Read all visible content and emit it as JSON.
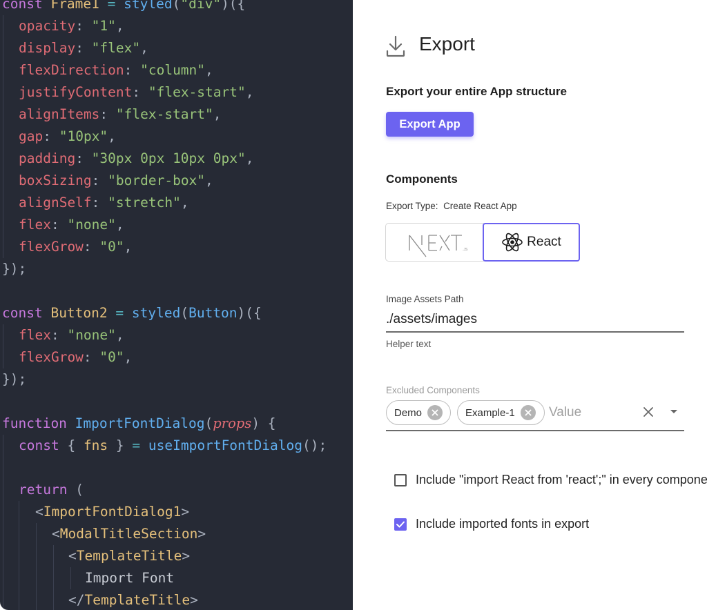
{
  "code_editor": {
    "lines": [
      {
        "indent": 0,
        "tokens": [
          [
            "kw",
            "const"
          ],
          [
            "txt",
            " "
          ],
          [
            "cls",
            "Frame1"
          ],
          [
            "txt",
            " "
          ],
          [
            "op",
            "="
          ],
          [
            "txt",
            " "
          ],
          [
            "fn",
            "styled"
          ],
          [
            "punc",
            "("
          ],
          [
            "str",
            "\"div\""
          ],
          [
            "punc",
            ")({"
          ]
        ]
      },
      {
        "indent": 1,
        "tokens": [
          [
            "prop",
            "opacity"
          ],
          [
            "punc",
            ": "
          ],
          [
            "str",
            "\"1\""
          ],
          [
            "punc",
            ","
          ]
        ]
      },
      {
        "indent": 1,
        "tokens": [
          [
            "prop",
            "display"
          ],
          [
            "punc",
            ": "
          ],
          [
            "str",
            "\"flex\""
          ],
          [
            "punc",
            ","
          ]
        ]
      },
      {
        "indent": 1,
        "tokens": [
          [
            "prop",
            "flexDirection"
          ],
          [
            "punc",
            ": "
          ],
          [
            "str",
            "\"column\""
          ],
          [
            "punc",
            ","
          ]
        ]
      },
      {
        "indent": 1,
        "tokens": [
          [
            "prop",
            "justifyContent"
          ],
          [
            "punc",
            ": "
          ],
          [
            "str",
            "\"flex-start\""
          ],
          [
            "punc",
            ","
          ]
        ]
      },
      {
        "indent": 1,
        "tokens": [
          [
            "prop",
            "alignItems"
          ],
          [
            "punc",
            ": "
          ],
          [
            "str",
            "\"flex-start\""
          ],
          [
            "punc",
            ","
          ]
        ]
      },
      {
        "indent": 1,
        "tokens": [
          [
            "prop",
            "gap"
          ],
          [
            "punc",
            ": "
          ],
          [
            "str",
            "\"10px\""
          ],
          [
            "punc",
            ","
          ]
        ]
      },
      {
        "indent": 1,
        "tokens": [
          [
            "prop",
            "padding"
          ],
          [
            "punc",
            ": "
          ],
          [
            "str",
            "\"30px 0px 10px 0px\""
          ],
          [
            "punc",
            ","
          ]
        ]
      },
      {
        "indent": 1,
        "tokens": [
          [
            "prop",
            "boxSizing"
          ],
          [
            "punc",
            ": "
          ],
          [
            "str",
            "\"border-box\""
          ],
          [
            "punc",
            ","
          ]
        ]
      },
      {
        "indent": 1,
        "tokens": [
          [
            "prop",
            "alignSelf"
          ],
          [
            "punc",
            ": "
          ],
          [
            "str",
            "\"stretch\""
          ],
          [
            "punc",
            ","
          ]
        ]
      },
      {
        "indent": 1,
        "tokens": [
          [
            "prop",
            "flex"
          ],
          [
            "punc",
            ": "
          ],
          [
            "str",
            "\"none\""
          ],
          [
            "punc",
            ","
          ]
        ]
      },
      {
        "indent": 1,
        "tokens": [
          [
            "prop",
            "flexGrow"
          ],
          [
            "punc",
            ": "
          ],
          [
            "str",
            "\"0\""
          ],
          [
            "punc",
            ","
          ]
        ]
      },
      {
        "indent": 0,
        "tokens": [
          [
            "punc",
            "});"
          ]
        ]
      },
      {
        "indent": 0,
        "tokens": []
      },
      {
        "indent": 0,
        "tokens": [
          [
            "kw",
            "const"
          ],
          [
            "txt",
            " "
          ],
          [
            "cls",
            "Button2"
          ],
          [
            "txt",
            " "
          ],
          [
            "op",
            "="
          ],
          [
            "txt",
            " "
          ],
          [
            "fn",
            "styled"
          ],
          [
            "punc",
            "("
          ],
          [
            "fn",
            "Button"
          ],
          [
            "punc",
            ")({"
          ]
        ]
      },
      {
        "indent": 1,
        "tokens": [
          [
            "prop",
            "flex"
          ],
          [
            "punc",
            ": "
          ],
          [
            "str",
            "\"none\""
          ],
          [
            "punc",
            ","
          ]
        ]
      },
      {
        "indent": 1,
        "tokens": [
          [
            "prop",
            "flexGrow"
          ],
          [
            "punc",
            ": "
          ],
          [
            "str",
            "\"0\""
          ],
          [
            "punc",
            ","
          ]
        ]
      },
      {
        "indent": 0,
        "tokens": [
          [
            "punc",
            "});"
          ]
        ]
      },
      {
        "indent": 0,
        "tokens": []
      },
      {
        "indent": 0,
        "tokens": [
          [
            "kw",
            "function"
          ],
          [
            "txt",
            " "
          ],
          [
            "fn",
            "ImportFontDialog"
          ],
          [
            "punc",
            "("
          ],
          [
            "param",
            "props"
          ],
          [
            "punc",
            ") {"
          ]
        ]
      },
      {
        "indent": 1,
        "tokens": [
          [
            "kw",
            "const"
          ],
          [
            "punc",
            " { "
          ],
          [
            "cls",
            "fns"
          ],
          [
            "punc",
            " } "
          ],
          [
            "op",
            "="
          ],
          [
            "txt",
            " "
          ],
          [
            "fn",
            "useImportFontDialog"
          ],
          [
            "punc",
            "();"
          ]
        ]
      },
      {
        "indent": 0,
        "tokens": []
      },
      {
        "indent": 1,
        "tokens": [
          [
            "kw",
            "return"
          ],
          [
            "punc",
            " ("
          ]
        ]
      },
      {
        "indent": 2,
        "tokens": [
          [
            "tagp",
            "<"
          ],
          [
            "tag",
            "ImportFontDialog1"
          ],
          [
            "tagp",
            ">"
          ]
        ]
      },
      {
        "indent": 3,
        "tokens": [
          [
            "tagp",
            "<"
          ],
          [
            "tag",
            "ModalTitleSection"
          ],
          [
            "tagp",
            ">"
          ]
        ]
      },
      {
        "indent": 4,
        "tokens": [
          [
            "tagp",
            "<"
          ],
          [
            "tag",
            "TemplateTitle"
          ],
          [
            "tagp",
            ">"
          ]
        ]
      },
      {
        "indent": 5,
        "tokens": [
          [
            "txt",
            "Import Font"
          ]
        ]
      },
      {
        "indent": 4,
        "tokens": [
          [
            "tagp",
            "</"
          ],
          [
            "tag",
            "TemplateTitle"
          ],
          [
            "tagp",
            ">"
          ]
        ]
      }
    ]
  },
  "export_panel": {
    "title": "Export",
    "title_icon": "download-icon",
    "app_section": {
      "heading": "Export your entire App structure",
      "button_label": "Export App"
    },
    "components_section": {
      "heading": "Components",
      "export_type_label": "Export Type:",
      "export_type_value": "Create React App",
      "toggle_options": [
        {
          "id": "next",
          "label": "NEXT.js",
          "logo": "nextjs-logo",
          "selected": false
        },
        {
          "id": "react",
          "label": "React",
          "logo": "react-logo",
          "selected": true
        }
      ]
    },
    "image_assets": {
      "label": "Image Assets Path",
      "value": "./assets/images",
      "helper_text": "Helper text"
    },
    "excluded_components": {
      "label": "Excluded Components",
      "chips": [
        "Demo",
        "Example-1"
      ],
      "placeholder": "Value"
    },
    "checkboxes": [
      {
        "label": "Include \"import React from 'react';\" in every component",
        "checked": false
      },
      {
        "label": "Include imported fonts in export",
        "checked": true
      }
    ],
    "colors": {
      "accent": "#6c63f0",
      "code_background": "#262a35"
    }
  }
}
